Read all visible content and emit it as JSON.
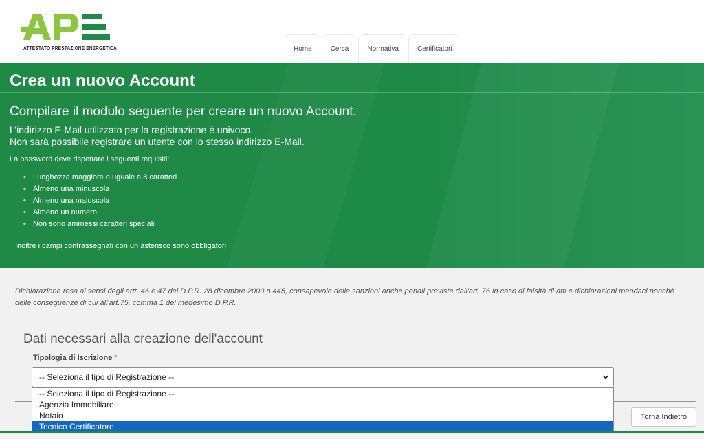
{
  "logo": {
    "text": "APE",
    "tagline": "ATTESTATO PRESTAZIONE ENERGETICA",
    "colors": {
      "primary": "#8cc63f",
      "secondary": "#1f8a45"
    }
  },
  "nav": {
    "items": [
      "Home",
      "Cerca",
      "Normativa",
      "Certificatori"
    ]
  },
  "banner": {
    "title": "Crea un nuovo Account",
    "subtitle": "Compilare il modulo seguente per creare un nuovo Account.",
    "unique_line1": "L’indirizzo E-Mail utilizzato per la registrazione è univoco.",
    "unique_line2": "Non sarà possibile registrare un utente con lo stesso indirizzo E-Mail.",
    "requirements_intro": "La password deve rispettare i seguenti requisiti:",
    "requirements": [
      "Lunghezza maggiore o uguale a 8 caratteri",
      "Almeno una minuscola",
      "Almeno una maiuscola",
      "Almeno un numero",
      "Non sono ammessi caratteri speciali"
    ],
    "required_note": "Inoltre i campi contrassegnati con un asterisco sono obbligatori",
    "color": "#1f8a45"
  },
  "declaration": "Dichiarazione resa ai sensi degli artt. 46 e 47 del D.P.R. 28 dicembre 2000 n.445, consapevole delle sanzioni anche penali previste dall'art. 76 in caso di falsità di atti e dichiarazioni mendaci nonchè delle conseguenze di cui all'art.75, comma 1 del medesimo D.P.R.",
  "form": {
    "section_title": "Dati necessari alla creazione dell'account",
    "field_label": "Tipologia di Iscrizione",
    "required_marker": "*",
    "select_value": "-- Seleziona il tipo di Registrazione --",
    "options": [
      "-- Seleziona il tipo di Registrazione --",
      "Agenzia Immobiliare",
      "Notaio",
      "Tecnico Certificatore"
    ],
    "highlighted_option": "Tecnico Certificatore",
    "highlight_color": "#1466c9"
  },
  "buttons": {
    "back": "Torna Indietro"
  }
}
